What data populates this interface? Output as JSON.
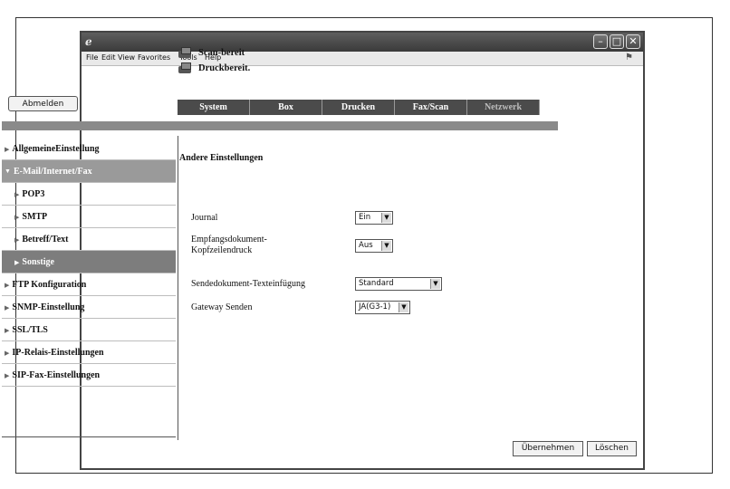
{
  "menubar": {
    "items": [
      "File",
      "Edit",
      "View",
      "Favorites",
      "Tools",
      "Help"
    ]
  },
  "status": {
    "scan": "Scan-bereit",
    "print": "Druckbereit."
  },
  "logout_label": "Abmelden",
  "tabs": [
    "System",
    "Box",
    "Drucken",
    "Fax/Scan",
    "Netzwerk"
  ],
  "sidebar": {
    "items": [
      {
        "label": "AllgemeineEinstellung"
      },
      {
        "label": "E-Mail/Internet/Fax"
      },
      {
        "label": "POP3"
      },
      {
        "label": "SMTP"
      },
      {
        "label": "Betreff/Text"
      },
      {
        "label": "Sonstige"
      },
      {
        "label": "FTP Konfiguration"
      },
      {
        "label": "SNMP-Einstellung"
      },
      {
        "label": "SSL/TLS"
      },
      {
        "label": "IP-Relais-Einstellungen"
      },
      {
        "label": "SIP-Fax-Einstellungen"
      }
    ]
  },
  "content": {
    "title": "Andere Einstellungen",
    "fields": [
      {
        "label": "Journal",
        "value": "Ein"
      },
      {
        "label": "Empfangsdokument-\nKopfzeilendruck",
        "value": "Aus"
      },
      {
        "label": "Sendedokument-Texteinfügung",
        "value": "Standard"
      },
      {
        "label": "Gateway Senden",
        "value": "JA(G3-1)"
      }
    ]
  },
  "buttons": {
    "apply": "Übernehmen",
    "delete": "Löschen"
  }
}
